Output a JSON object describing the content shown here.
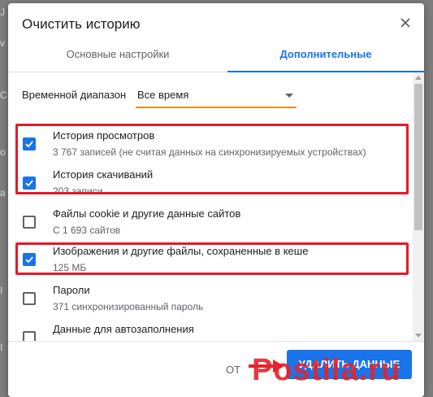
{
  "background": {
    "fragments": [
      "J",
      "v",
      "C",
      "o",
      "a",
      "I",
      "I"
    ]
  },
  "dialog": {
    "title": "Очистить историю",
    "close_icon": "close-icon"
  },
  "tabs": [
    {
      "label": "Основные настройки",
      "active": false
    },
    {
      "label": "Дополнительные",
      "active": true
    }
  ],
  "time_range": {
    "label": "Временной диапазон",
    "value": "Все время"
  },
  "items": [
    {
      "title": "История просмотров",
      "subtitle": "3 767 записей (не считая данных на синхронизируемых устройствах)",
      "checked": true
    },
    {
      "title": "История скачиваний",
      "subtitle": "203 записи",
      "checked": true
    },
    {
      "title": "Файлы cookie и другие данные сайтов",
      "subtitle": "С 1 693 сайтов",
      "checked": false
    },
    {
      "title": "Изображения и другие файлы, сохраненные в кеше",
      "subtitle": "125 МБ",
      "checked": true
    },
    {
      "title": "Пароли",
      "subtitle": "371 синхронизированный пароль",
      "checked": false
    },
    {
      "title": "Данные для автозаполнения",
      "subtitle": "",
      "checked": false
    }
  ],
  "footer": {
    "cancel_label": "ОТ",
    "clear_label": "УДАЛИТЬ ДАННЫЕ"
  },
  "watermark": {
    "text": "Postila.ru"
  },
  "colors": {
    "accent": "#1a73e8",
    "highlight": "#e5192a",
    "underline": "#f08a1c"
  }
}
